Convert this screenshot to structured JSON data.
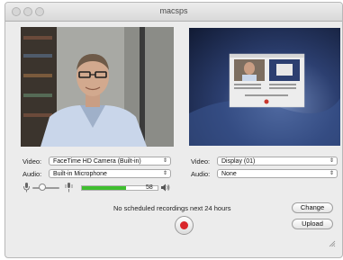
{
  "window": {
    "title": "macsps"
  },
  "left_panel": {
    "video_label": "Video:",
    "video_source": "FaceTime HD Camera (Built-in)",
    "audio_label": "Audio:",
    "audio_source": "Built-in Microphone",
    "level_value": "58",
    "volume_slider_level": 0.35,
    "audio_level_fraction": 0.58
  },
  "right_panel": {
    "video_label": "Video:",
    "video_source": "Display (01)",
    "audio_label": "Audio:",
    "audio_source": "None"
  },
  "status_text": "No scheduled recordings next 24 hours",
  "buttons": {
    "change": "Change",
    "upload": "Upload"
  },
  "colors": {
    "record": "#d9262b",
    "level_meter": "#3fbf2f",
    "window_bg": "#ececec"
  }
}
